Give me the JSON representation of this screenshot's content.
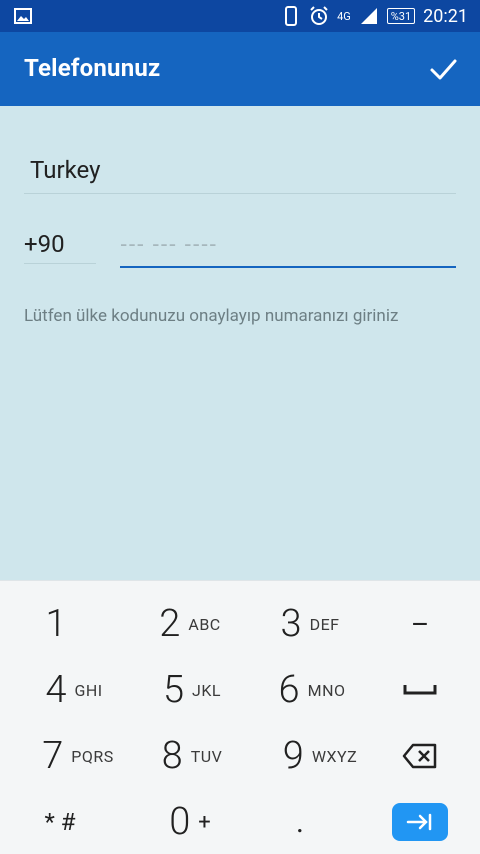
{
  "status_bar": {
    "time": "20:21",
    "battery": "%31",
    "network": "4G"
  },
  "app_bar": {
    "title": "Telefonunuz"
  },
  "form": {
    "country": "Turkey",
    "country_code": "+90",
    "phone_placeholder": "--- --- ----",
    "hint": "Lütfen ülke kodunuzu onaylayıp numaranızı giriniz"
  },
  "keypad": {
    "row1": [
      {
        "num": "1",
        "letters": ""
      },
      {
        "num": "2",
        "letters": "ABC"
      },
      {
        "num": "3",
        "letters": "DEF"
      }
    ],
    "row2": [
      {
        "num": "4",
        "letters": "GHI"
      },
      {
        "num": "5",
        "letters": "JKL"
      },
      {
        "num": "6",
        "letters": "MNO"
      }
    ],
    "row3": [
      {
        "num": "7",
        "letters": "PQRS"
      },
      {
        "num": "8",
        "letters": "TUV"
      },
      {
        "num": "9",
        "letters": "WXYZ"
      }
    ],
    "row4": {
      "left": "* #",
      "zero": "0",
      "zero_sub": "+",
      "dot": "."
    },
    "dash": "–"
  },
  "colors": {
    "primary": "#1565c0",
    "status": "#0d47a1",
    "content_bg": "#cfe6ec",
    "accent": "#2196f3"
  }
}
